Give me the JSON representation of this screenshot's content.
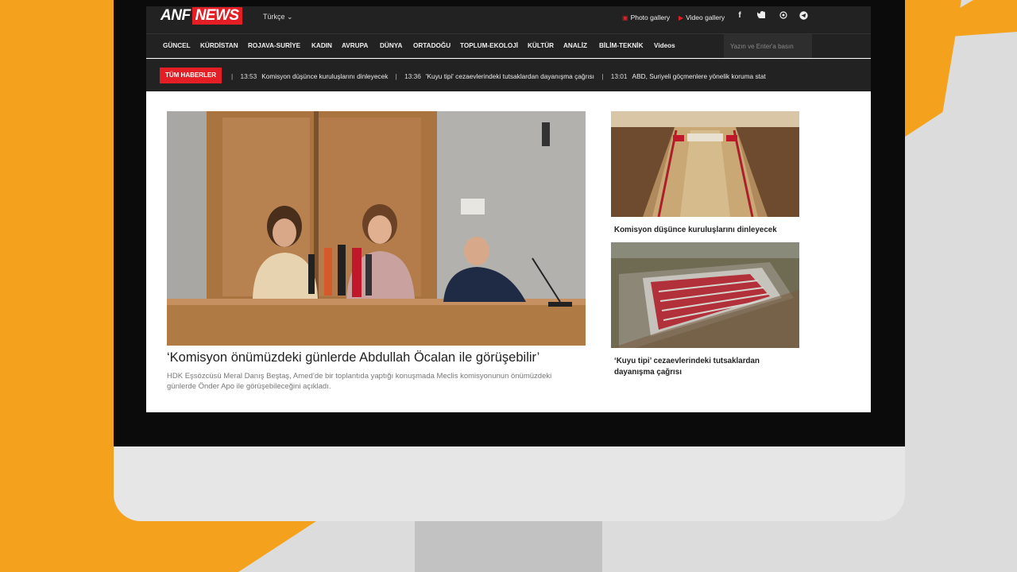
{
  "site": {
    "logo_primary": "ANF",
    "logo_secondary": "NEWS",
    "language": "Türkçe",
    "photo_gallery": "Photo gallery",
    "video_gallery": "Video gallery"
  },
  "social": [
    "f",
    "t",
    "w",
    "tg"
  ],
  "nav": [
    "GÜNCEL",
    "KÜRDİSTAN",
    "ROJAVA-SURİYE",
    "KADIN",
    "AVRUPA",
    "DÜNYA",
    "ORTADOĞU",
    "TOPLUM-EKOLOJİ",
    "KÜLTÜR",
    "ANALİZ",
    "BİLİM-TEKNİK",
    "Videos"
  ],
  "search": {
    "placeholder": "Yazın ve Enter'a basın"
  },
  "ticker": {
    "label": "TÜM HABERLER",
    "items": [
      {
        "time": "13:53",
        "text": "Komisyon düşünce kuruluşlarını dinleyecek"
      },
      {
        "time": "13:36",
        "text": "'Kuyu tipi' cezaevlerindeki tutsaklardan dayanışma çağrısı"
      },
      {
        "time": "13:01",
        "text": "ABD, Suriyeli göçmenlere yönelik koruma stat"
      }
    ]
  },
  "main_story": {
    "title": "‘Komisyon önümüzdeki günlerde Abdullah Öcalan ile görüşebilir’",
    "description": "HDK Eşsözcüsü Meral Danış Beştaş, Amed’de bir toplantıda yaptığı konuşmada Meclis komisyonunun önümüzdeki günlerde Önder Apo ile görüşebileceğini açıkladı."
  },
  "side_stories": [
    {
      "title": "Komisyon düşünce kuruluşlarını dinleyecek"
    },
    {
      "title": "‘Kuyu tipi’ cezaevlerindeki tutsaklardan dayanışma çağrısı"
    }
  ],
  "colors": {
    "accent": "#e31e24",
    "bar": "#222222",
    "background": "#f4a21e",
    "monitor": "#e6e6e6"
  }
}
